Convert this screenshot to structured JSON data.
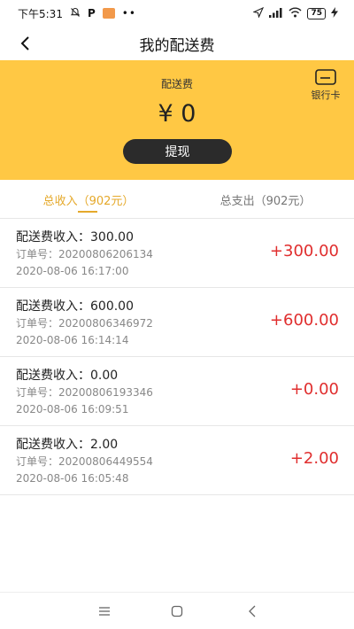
{
  "status_bar": {
    "time": "下午5:31",
    "battery": "75"
  },
  "header": {
    "title": "我的配送费"
  },
  "summary": {
    "label": "配送费",
    "amount": "¥ 0",
    "withdraw_label": "提现",
    "bank_card_label": "银行卡"
  },
  "tabs": [
    {
      "label": "总收入（902元）",
      "active": true
    },
    {
      "label": "总支出（902元）",
      "active": false
    }
  ],
  "records": [
    {
      "title": "配送费收入：300.00",
      "order": "订单号：20200806206134",
      "time": "2020-08-06 16:17:00",
      "amount": "+300.00"
    },
    {
      "title": "配送费收入：600.00",
      "order": "订单号：20200806346972",
      "time": "2020-08-06 16:14:14",
      "amount": "+600.00"
    },
    {
      "title": "配送费收入：0.00",
      "order": "订单号：20200806193346",
      "time": "2020-08-06 16:09:51",
      "amount": "+0.00"
    },
    {
      "title": "配送费收入：2.00",
      "order": "订单号：20200806449554",
      "time": "2020-08-06 16:05:48",
      "amount": "+2.00"
    }
  ],
  "colors": {
    "accent": "#ffc844",
    "tab_active": "#e5a92b",
    "amount": "#e02e2e",
    "button": "#2b2b2b"
  }
}
